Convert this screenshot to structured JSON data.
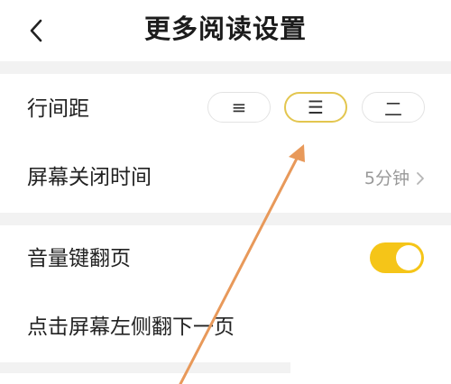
{
  "header": {
    "title": "更多阅读设置",
    "back_icon": "chevron-left-icon"
  },
  "line_spacing": {
    "label": "行间距",
    "options": [
      "≡",
      "☰",
      "二"
    ],
    "selected_index": 1
  },
  "screen_off": {
    "label": "屏幕关闭时间",
    "value": "5分钟",
    "chevron_icon": "chevron-right-icon"
  },
  "volume_key": {
    "label": "音量键翻页",
    "enabled": true
  },
  "tap_left": {
    "label": "点击屏幕左侧翻下一页"
  },
  "colors": {
    "accent": "#f5c518",
    "selected_border": "#e3c64f",
    "divider": "#f2f2f2",
    "annotation_arrow": "#e8995a"
  }
}
